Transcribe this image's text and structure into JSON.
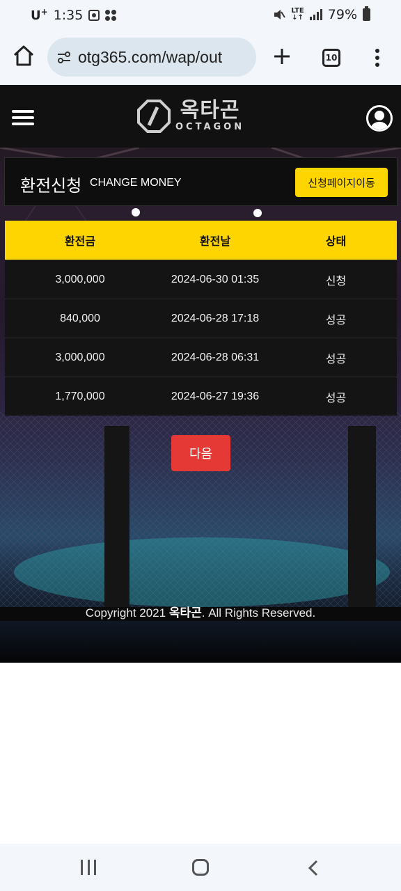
{
  "status_bar": {
    "carrier": "U",
    "carrier_sup": "+",
    "time": "1:35",
    "network": "LTE",
    "battery": "79%"
  },
  "browser": {
    "url": "otg365.com/wap/out",
    "tab_count": "10"
  },
  "site": {
    "logo_ko": "옥타곤",
    "logo_en": "OCTAGON"
  },
  "page": {
    "title_ko": "환전신청",
    "title_en": "CHANGE MONEY",
    "apply_button": "신청페이지이동"
  },
  "table": {
    "headers": [
      "환전금",
      "환전날",
      "상태"
    ],
    "rows": [
      {
        "amount": "3,000,000",
        "date": "2024-06-30 01:35",
        "status": "신청"
      },
      {
        "amount": "840,000",
        "date": "2024-06-28 17:18",
        "status": "성공"
      },
      {
        "amount": "3,000,000",
        "date": "2024-06-28 06:31",
        "status": "성공"
      },
      {
        "amount": "1,770,000",
        "date": "2024-06-27 19:36",
        "status": "성공"
      }
    ]
  },
  "pagination": {
    "next_label": "다음"
  },
  "footer": {
    "copyright_prefix": "Copyright 2021 ",
    "copyright_brand": "옥타곤",
    "copyright_suffix": ". All Rights Reserved."
  },
  "colors": {
    "accent_yellow": "#ffd500",
    "next_red": "#e53935",
    "header_bg": "#111111"
  }
}
